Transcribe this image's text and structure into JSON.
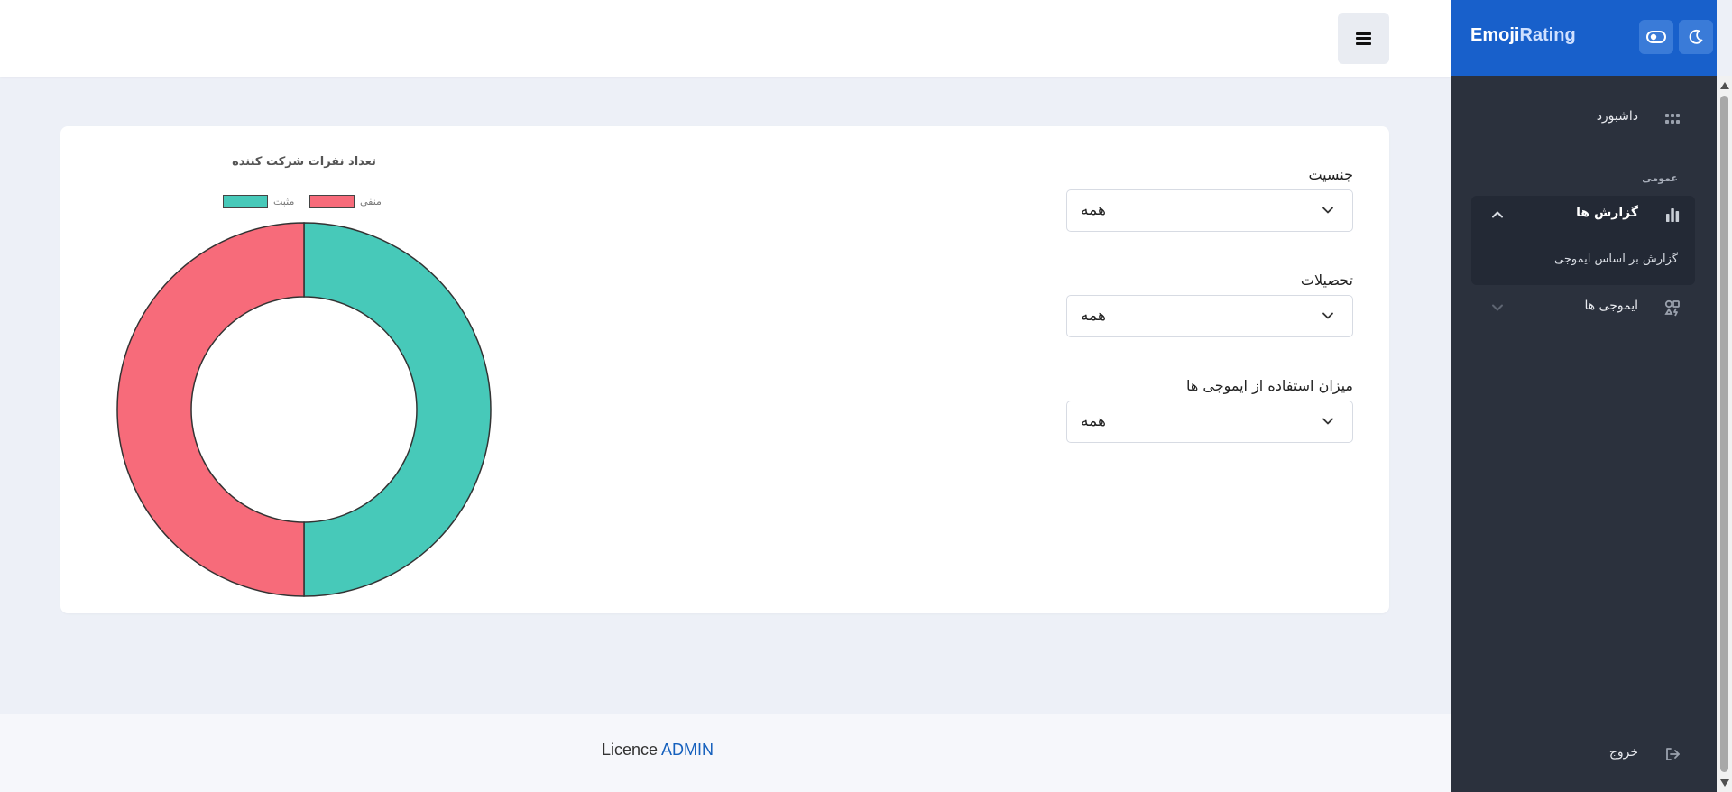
{
  "header": {
    "menu_icon": "hamburger-icon"
  },
  "brand": {
    "part1": "Emoji",
    "part2": "Rating"
  },
  "header_buttons": [
    {
      "icon": "toggle-icon"
    },
    {
      "icon": "moon-icon"
    }
  ],
  "sidebar": {
    "dashboard": "داشبورد",
    "section_general": "عمومی",
    "reports": "گزارش ها",
    "reports_sub": "گزارش بر اساس ایموجی",
    "emojis": "ایموجی ها",
    "logout": "خروج"
  },
  "filters": [
    {
      "label": "جنسیت",
      "value": "همه"
    },
    {
      "label": "تحصیلات",
      "value": "همه"
    },
    {
      "label": "میزان استفاده از ایموجی ها",
      "value": "همه"
    }
  ],
  "chart_data": {
    "type": "pie",
    "subtype": "doughnut",
    "title": "تعداد نفرات شرکت کننده",
    "legend_position": "top",
    "categories": [
      "منفی",
      "مثبت"
    ],
    "values": [
      1,
      1
    ],
    "colors": [
      "#f76b7a",
      "#47c9b9"
    ]
  },
  "footer": {
    "licence": "Licence",
    "admin": "ADMIN"
  }
}
